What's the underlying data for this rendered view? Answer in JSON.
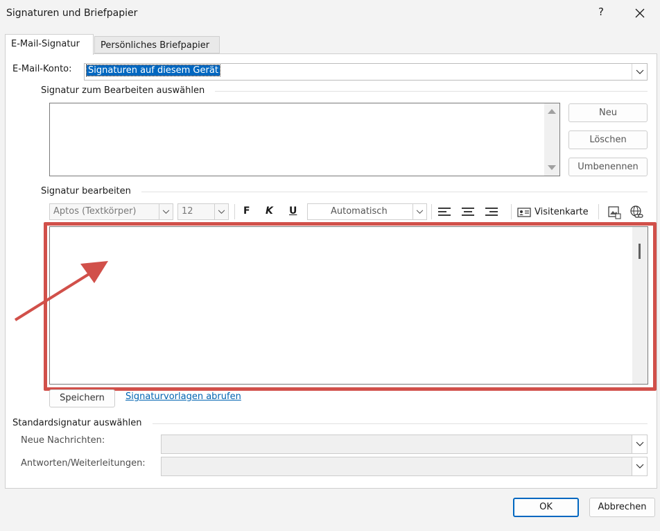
{
  "window": {
    "title": "Signaturen und Briefpapier",
    "help_label": "?",
    "close_label": "✕"
  },
  "tabs": [
    {
      "label": "E-Mail-Signatur",
      "active": true
    },
    {
      "label": "Persönliches Briefpapier",
      "active": false
    }
  ],
  "account": {
    "label": "E-Mail-Konto:",
    "value": "Signaturen auf diesem Gerät"
  },
  "select_signature": {
    "heading": "Signatur zum Bearbeiten auswählen",
    "buttons": {
      "new": "Neu",
      "delete": "Löschen",
      "rename": "Umbenennen"
    }
  },
  "edit_signature": {
    "heading": "Signatur bearbeiten",
    "font": "Aptos (Textkörper)",
    "size": "12",
    "bold": "F",
    "italic": "K",
    "underline": "U",
    "color": "Automatisch",
    "business_card": "Visitenkarte",
    "save": "Speichern",
    "templates_link": "Signaturvorlagen abrufen"
  },
  "default_signature": {
    "heading": "Standardsignatur auswählen",
    "new_messages_label": "Neue Nachrichten:",
    "new_messages_value": "",
    "replies_label": "Antworten/Weiterleitungen:",
    "replies_value": ""
  },
  "footer": {
    "ok": "OK",
    "cancel": "Abbrechen"
  },
  "annotation": {
    "color": "#d1504a"
  }
}
